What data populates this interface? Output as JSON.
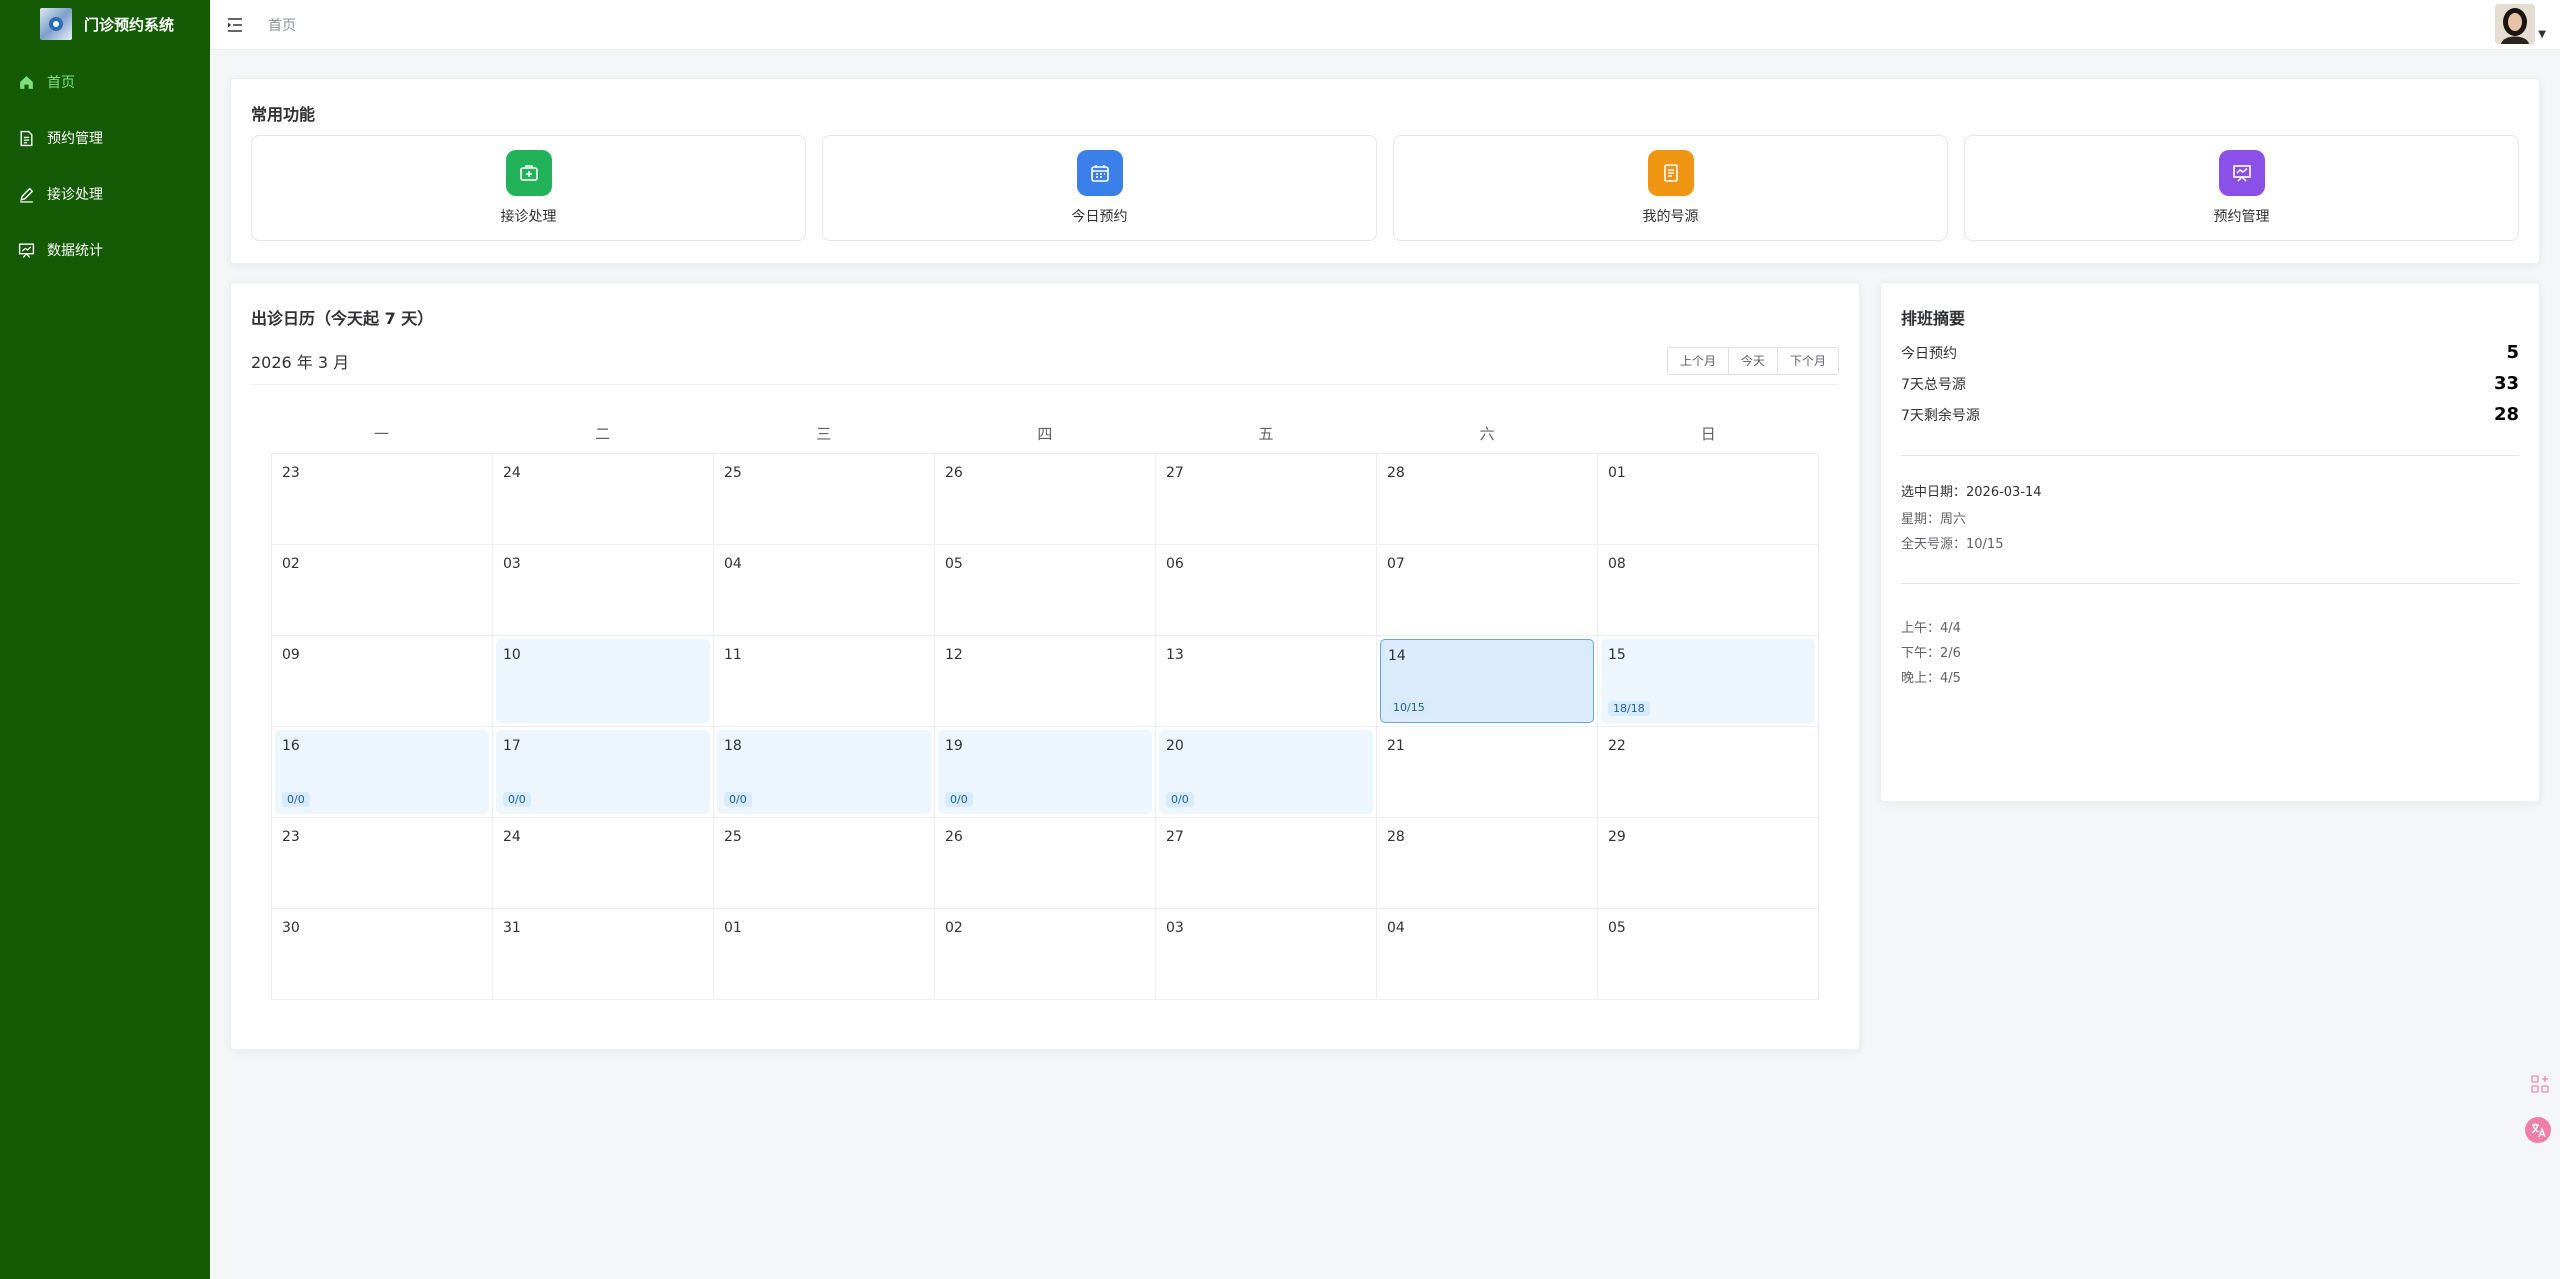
{
  "app": {
    "title": "门诊预约系统"
  },
  "sidebar": {
    "items": [
      {
        "label": "首页",
        "icon": "home-icon",
        "active": true
      },
      {
        "label": "预约管理",
        "icon": "document-icon"
      },
      {
        "label": "接诊处理",
        "icon": "edit-icon"
      },
      {
        "label": "数据统计",
        "icon": "chart-icon"
      }
    ]
  },
  "header": {
    "breadcrumb": "首页"
  },
  "quick": {
    "title": "常用功能",
    "items": [
      {
        "label": "接诊处理",
        "color": "#22b35a"
      },
      {
        "label": "今日预约",
        "color": "#3b7fe8"
      },
      {
        "label": "我的号源",
        "color": "#ef9512"
      },
      {
        "label": "预约管理",
        "color": "#8b50e8"
      }
    ]
  },
  "calendar": {
    "title": "出诊日历（今天起 7 天）",
    "month_label": "2026 年 3 月",
    "buttons": {
      "prev": "上个月",
      "today": "今天",
      "next": "下个月"
    },
    "weekdays": [
      "一",
      "二",
      "三",
      "四",
      "五",
      "六",
      "日"
    ],
    "rows": [
      [
        {
          "d": "23"
        },
        {
          "d": "24"
        },
        {
          "d": "25"
        },
        {
          "d": "26"
        },
        {
          "d": "27"
        },
        {
          "d": "28"
        },
        {
          "d": "01"
        }
      ],
      [
        {
          "d": "02"
        },
        {
          "d": "03"
        },
        {
          "d": "04"
        },
        {
          "d": "05"
        },
        {
          "d": "06"
        },
        {
          "d": "07"
        },
        {
          "d": "08"
        }
      ],
      [
        {
          "d": "09"
        },
        {
          "d": "10",
          "hl": true
        },
        {
          "d": "11"
        },
        {
          "d": "12"
        },
        {
          "d": "13"
        },
        {
          "d": "14",
          "sel": true,
          "badge": "10/15"
        },
        {
          "d": "15",
          "hl": true,
          "badge": "18/18"
        }
      ],
      [
        {
          "d": "16",
          "hl": true,
          "badge": "0/0"
        },
        {
          "d": "17",
          "hl": true,
          "badge": "0/0"
        },
        {
          "d": "18",
          "hl": true,
          "badge": "0/0"
        },
        {
          "d": "19",
          "hl": true,
          "badge": "0/0"
        },
        {
          "d": "20",
          "hl": true,
          "badge": "0/0"
        },
        {
          "d": "21"
        },
        {
          "d": "22"
        }
      ],
      [
        {
          "d": "23"
        },
        {
          "d": "24"
        },
        {
          "d": "25"
        },
        {
          "d": "26"
        },
        {
          "d": "27"
        },
        {
          "d": "28"
        },
        {
          "d": "29"
        }
      ],
      [
        {
          "d": "30"
        },
        {
          "d": "31"
        },
        {
          "d": "01"
        },
        {
          "d": "02"
        },
        {
          "d": "03"
        },
        {
          "d": "04"
        },
        {
          "d": "05"
        }
      ]
    ]
  },
  "summary": {
    "title": "排班摘要",
    "stats": [
      {
        "label": "今日预约",
        "value": "5"
      },
      {
        "label": "7天总号源",
        "value": "33"
      },
      {
        "label": "7天剩余号源",
        "value": "28"
      }
    ],
    "selected_date": "选中日期：2026-03-14",
    "weekday": "星期：周六",
    "full_day": "全天号源：10/15",
    "periods": [
      "上午：4/4",
      "下午：2/6",
      "晚上：4/5"
    ]
  }
}
